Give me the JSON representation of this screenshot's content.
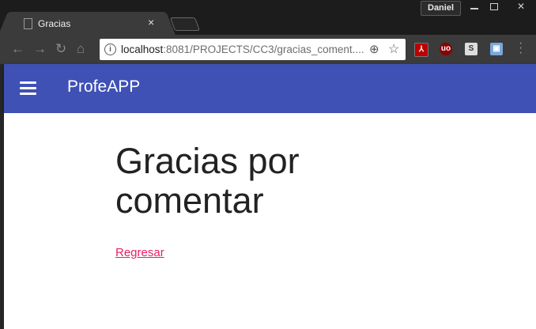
{
  "window": {
    "user": "Daniel"
  },
  "tab": {
    "title": "Gracias",
    "close": "×"
  },
  "address": {
    "host": "localhost",
    "rest": ":8081/PROJECTS/CC3/gracias_coment...."
  },
  "extensions": {
    "pdf": "⅄",
    "ublock": "uo",
    "s": "S",
    "screen": "▣"
  },
  "app": {
    "title": "ProfeAPP"
  },
  "main": {
    "heading": "Gracias por comentar",
    "link": "Regresar"
  },
  "colors": {
    "primary": "#3f51b5",
    "accent": "#e91e63"
  }
}
